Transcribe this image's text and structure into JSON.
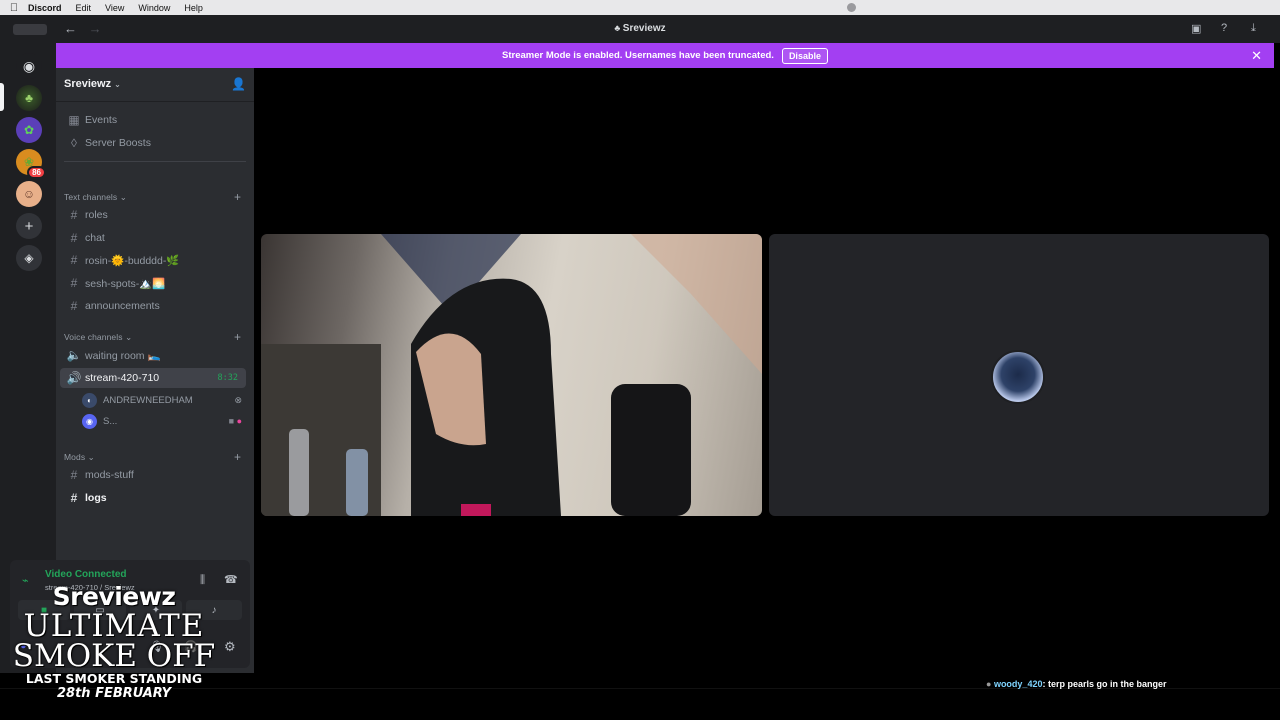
{
  "menubar": {
    "apple": "",
    "app": "Discord",
    "items": [
      "Edit",
      "View",
      "Window",
      "Help"
    ]
  },
  "titlebar": {
    "back": "←",
    "forward": "→",
    "title": "Sreviewz"
  },
  "streamer_banner": {
    "text": "Streamer Mode is enabled. Usernames have been truncated.",
    "button": "Disable",
    "close": "✕",
    "color": "#a33ff2"
  },
  "rail": {
    "badge": "86"
  },
  "server": {
    "name": "Sreviewz",
    "top_items": [
      {
        "label": "Events",
        "icon": "calendar-icon"
      },
      {
        "label": "Server Boosts",
        "icon": "boost-icon"
      }
    ],
    "text_category": "Text channels",
    "text_channels": [
      "roles",
      "chat",
      "rosin-🌞-budddd-🌿",
      "sesh-spots-🏔️🌅",
      "announcements"
    ],
    "voice_category": "Voice channels",
    "voice_channels": [
      {
        "label": "waiting room 🛌",
        "active": false
      },
      {
        "label": "stream-420-710",
        "active": true,
        "timer": "8:32"
      }
    ],
    "voice_users": [
      {
        "name": "ANDREWNEEDHAM"
      },
      {
        "name": "S..."
      }
    ],
    "mods_category": "Mods",
    "mods_channels": [
      {
        "label": "mods-stuff",
        "bright": false
      },
      {
        "label": "logs",
        "bright": true
      }
    ]
  },
  "voice_panel": {
    "status": "Video Connected",
    "channel": "stream-420-710 / Sreviewz"
  },
  "overlay_logo": {
    "line1": "Sreviewz",
    "line2": "ULTIMATE",
    "line3": "SMOKE OFF",
    "line4": "LAST SMOKER STANDING",
    "line5": "28th FEBRUARY"
  },
  "chat_overlay": {
    "name": "woody_420",
    "message": "terp pearls go in the banger"
  }
}
